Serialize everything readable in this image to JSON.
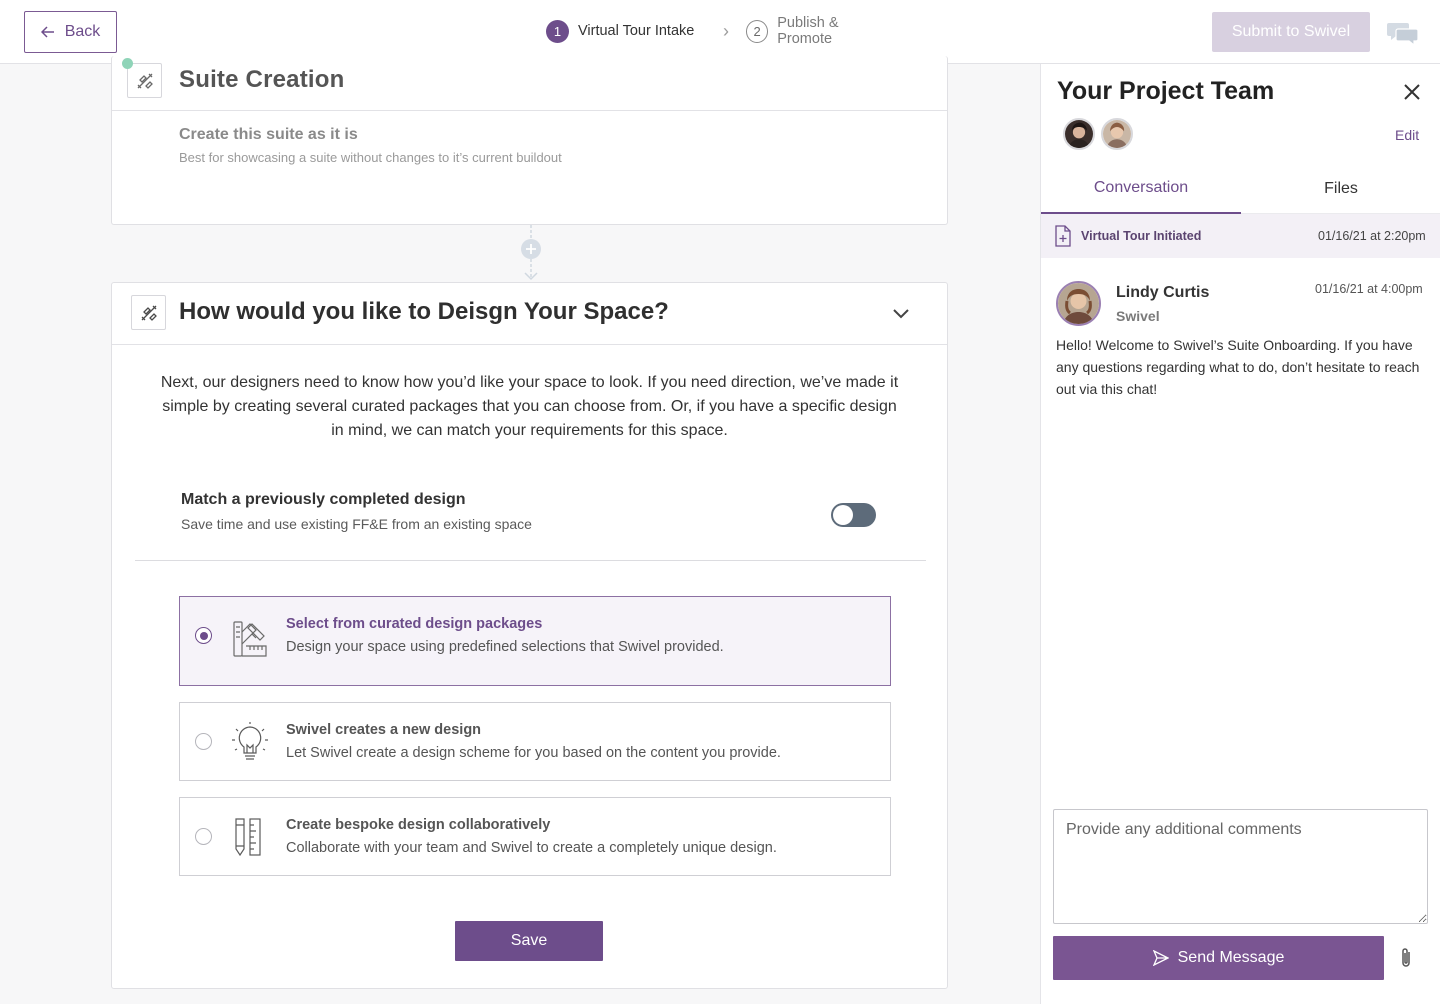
{
  "header": {
    "back_label": "Back",
    "steps": [
      {
        "num": "1",
        "label": "Virtual Tour Intake",
        "state": "active"
      },
      {
        "num": "2",
        "label": "Publish & Promote",
        "state": "inactive"
      }
    ],
    "submit_label": "Submit to Swivel"
  },
  "suite_card": {
    "title": "Suite Creation",
    "choice_title": "Create this suite as it is",
    "choice_sub": "Best for showcasing a suite without changes to it’s current buildout"
  },
  "design_card": {
    "title": "How would you like to Deisgn Your Space?",
    "intro": "Next, our designers need to know how you’d like your space to look. If you need direction, we’ve made it simple by creating several curated packages that you can choose from. Or, if you have a specific design in mind, we can match your requirements for this space.",
    "match_title": "Match a previously completed design",
    "match_sub": "Save time and use existing FF&E from an existing space",
    "match_enabled": false,
    "options": [
      {
        "title": "Select from curated design packages",
        "sub": "Design your space using predefined selections that Swivel provided.",
        "selected": true,
        "icon": "palette-ruler-icon"
      },
      {
        "title": "Swivel creates a new design",
        "sub": "Let Swivel create a design scheme for you based on the content you provide.",
        "selected": false,
        "icon": "lightbulb-icon"
      },
      {
        "title": "Create bespoke design collaboratively",
        "sub": "Collaborate with your team and Swivel to create a completely unique design.",
        "selected": false,
        "icon": "pencil-ruler-icon"
      }
    ],
    "save_label": "Save"
  },
  "panel": {
    "title": "Your Project Team",
    "edit_label": "Edit",
    "tabs": [
      {
        "label": "Conversation",
        "active": true
      },
      {
        "label": "Files",
        "active": false
      }
    ],
    "event": {
      "label": "Virtual Tour Initiated",
      "time": "01/16/21 at 2:20pm"
    },
    "message": {
      "name": "Lindy Curtis",
      "org": "Swivel",
      "time": "01/16/21 at 4:00pm",
      "body": "Hello! Welcome to Swivel’s Suite Onboarding. If you have any questions regarding what to do, don’t hesitate to reach out via this chat!"
    },
    "comment_placeholder": "Provide any additional comments",
    "send_label": "Send Message"
  },
  "colors": {
    "accent": "#6d4d8b",
    "accent_light": "#f6f3f9",
    "submit_disabled": "#d8d0e0",
    "toggle_off": "#5d6b7a",
    "status_dot": "#8fd4b8"
  }
}
